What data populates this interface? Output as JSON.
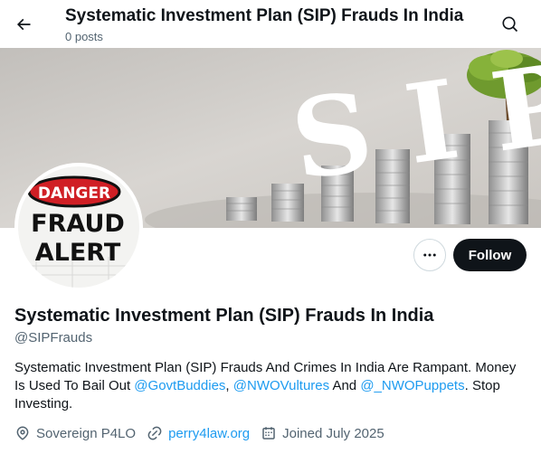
{
  "header": {
    "title": "Systematic Investment Plan (SIP) Frauds In India",
    "post_count": "0 posts"
  },
  "banner": {
    "sip_text": "SIP"
  },
  "avatar": {
    "danger_text": "DANGER",
    "fraud_text": "FRAUD",
    "alert_text": "ALERT"
  },
  "actions": {
    "follow_label": "Follow"
  },
  "profile": {
    "name": "Systematic Investment Plan (SIP) Frauds In India",
    "handle": "@SIPFrauds",
    "bio_part1": "Systematic Investment Plan (SIP) Frauds And Crimes In India Are Rampant. Money Is Used To Bail Out ",
    "mention1": "@GovtBuddies",
    "sep1": ", ",
    "mention2": "@NWOVultures",
    "sep2": " And ",
    "mention3": "@_NWOPuppets",
    "bio_part2": ". Stop Investing.",
    "location": "Sovereign P4LO",
    "website": "perry4law.org",
    "joined": "Joined July 2025"
  },
  "colors": {
    "accent": "#1d9bf0",
    "text": "#0f1419",
    "muted": "#536471",
    "follow_bg": "#0f1419"
  }
}
